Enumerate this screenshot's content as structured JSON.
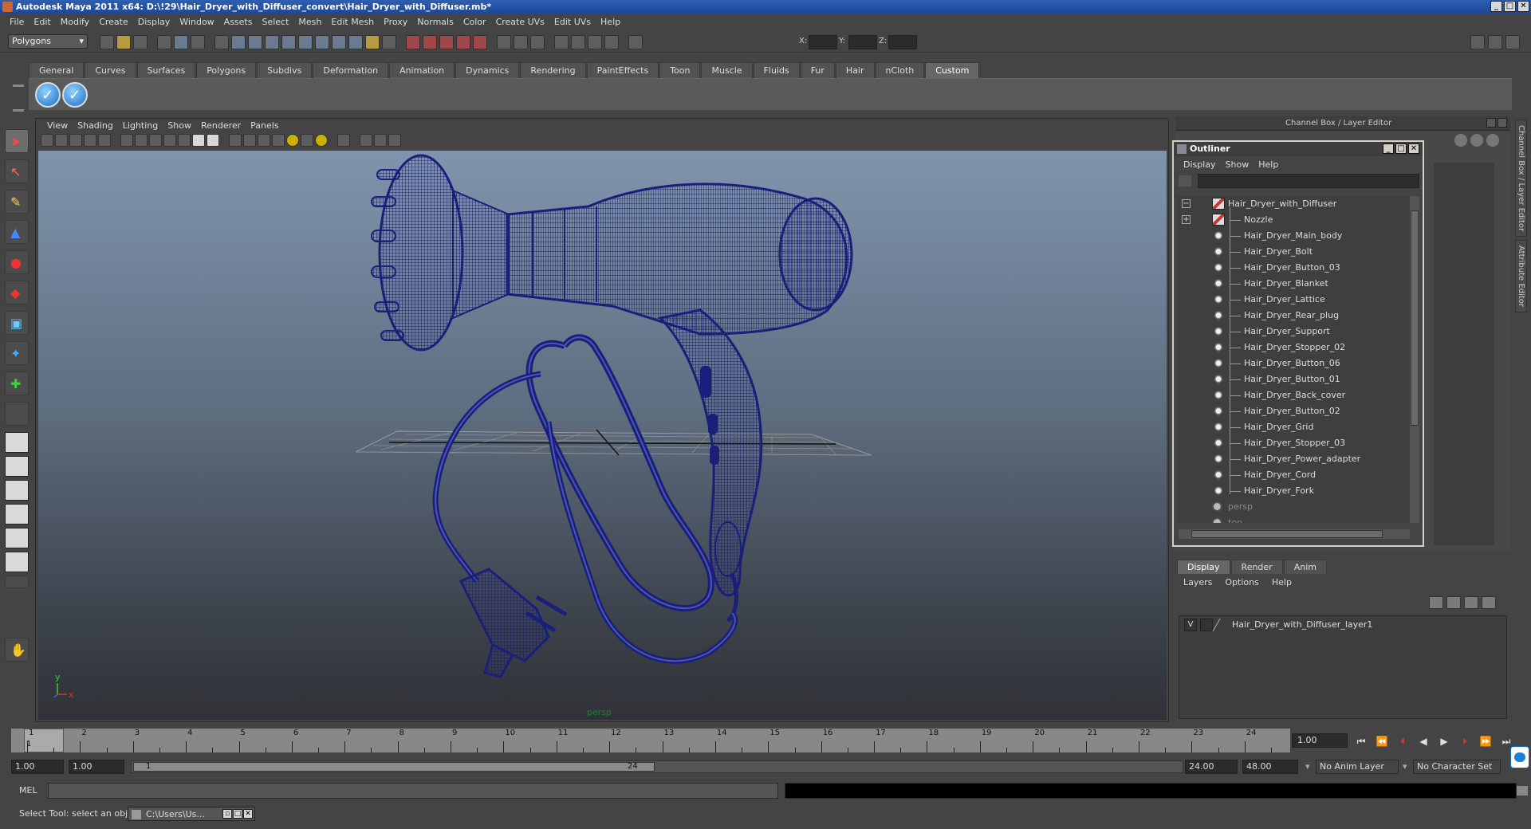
{
  "window": {
    "title": "Autodesk Maya 2011 x64: D:\\!29\\Hair_Dryer_with_Diffuser_convert\\Hair_Dryer_with_Diffuser.mb*",
    "controls": [
      "_",
      "□",
      "✕"
    ]
  },
  "menubar": [
    "File",
    "Edit",
    "Modify",
    "Create",
    "Display",
    "Window",
    "Assets",
    "Select",
    "Mesh",
    "Edit Mesh",
    "Proxy",
    "Normals",
    "Color",
    "Create UVs",
    "Edit UVs",
    "Help"
  ],
  "statusline": {
    "mode": "Polygons",
    "x_label": "X:",
    "y_label": "Y:",
    "z_label": "Z:"
  },
  "shelf": {
    "tabs": [
      "General",
      "Curves",
      "Surfaces",
      "Polygons",
      "Subdivs",
      "Deformation",
      "Animation",
      "Dynamics",
      "Rendering",
      "PaintEffects",
      "Toon",
      "Muscle",
      "Fluids",
      "Fur",
      "Hair",
      "nCloth",
      "Custom"
    ],
    "active_tab": "Custom"
  },
  "viewport": {
    "menu": [
      "View",
      "Shading",
      "Lighting",
      "Show",
      "Renderer",
      "Panels"
    ],
    "camera": "persp",
    "axis_x": "x",
    "axis_y": "y",
    "wire_color": "#1a1f7a"
  },
  "channel_box": {
    "title": "Channel Box / Layer Editor"
  },
  "side_tabs": [
    "Channel Box / Layer Editor",
    "Attribute Editor"
  ],
  "outliner": {
    "title": "Outliner",
    "menu": [
      "Display",
      "Show",
      "Help"
    ],
    "root": "Hair_Dryer_with_Diffuser",
    "children": [
      "Nozzle",
      "Hair_Dryer_Main_body",
      "Hair_Dryer_Bolt",
      "Hair_Dryer_Button_03",
      "Hair_Dryer_Blanket",
      "Hair_Dryer_Lattice",
      "Hair_Dryer_Rear_plug",
      "Hair_Dryer_Support",
      "Hair_Dryer_Stopper_02",
      "Hair_Dryer_Button_06",
      "Hair_Dryer_Button_01",
      "Hair_Dryer_Back_cover",
      "Hair_Dryer_Button_02",
      "Hair_Dryer_Grid",
      "Hair_Dryer_Stopper_03",
      "Hair_Dryer_Power_adapter",
      "Hair_Dryer_Cord",
      "Hair_Dryer_Fork"
    ],
    "cameras": [
      "persp",
      "top"
    ]
  },
  "layer_editor": {
    "tabs": [
      "Display",
      "Render",
      "Anim"
    ],
    "active_tab": "Display",
    "menu": [
      "Layers",
      "Options",
      "Help"
    ],
    "layer": {
      "visible": "V",
      "name": "Hair_Dryer_with_Diffuser_layer1"
    }
  },
  "timeline": {
    "start": 1,
    "end": 24,
    "current_frame": 1,
    "current_frame_field": "1.00",
    "frame_labels": [
      "1",
      "2",
      "3",
      "4",
      "5",
      "6",
      "7",
      "8",
      "9",
      "10",
      "11",
      "12",
      "13",
      "14",
      "15",
      "16",
      "17",
      "18",
      "19",
      "20",
      "21",
      "22",
      "23",
      "24"
    ]
  },
  "range": {
    "start_time": "1.00",
    "playback_start": "1.00",
    "range_low": "1",
    "range_high": "24",
    "playback_end": "24.00",
    "end_time": "48.00",
    "anim_layer": "No Anim Layer",
    "character_set": "No Character Set"
  },
  "command_line": {
    "label": "MEL"
  },
  "help_line": {
    "text": "Select Tool: select an object"
  },
  "taskbar": {
    "item": "C:\\Users\\Us..."
  }
}
